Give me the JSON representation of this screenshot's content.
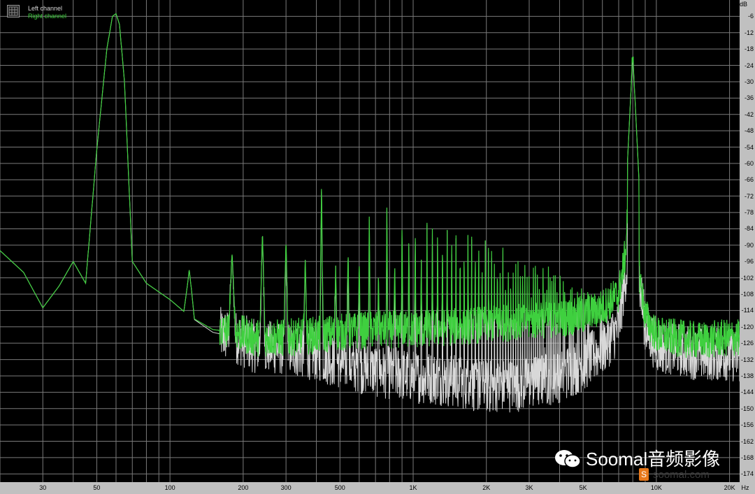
{
  "legend": {
    "left": "Left channel",
    "right": "Right channel",
    "left_color": "#d8d8d8",
    "right_color": "#3fd03f"
  },
  "watermark": {
    "icon": "wechat-icon",
    "text": "Soomal音频影像",
    "badge": "S",
    "site": "soomal.com"
  },
  "chart_data": {
    "type": "line",
    "title": "",
    "xlabel": "Hz",
    "ylabel": "dB",
    "x_scale": "log",
    "xlim": [
      20,
      22000
    ],
    "ylim": [
      -177,
      0
    ],
    "grid": true,
    "background": "#000000",
    "y_ticks": [
      -6,
      -12,
      -18,
      -24,
      -30,
      -36,
      -42,
      -48,
      -54,
      -60,
      -66,
      -72,
      -78,
      -84,
      -90,
      -96,
      -102,
      -108,
      -114,
      -120,
      -126,
      -132,
      -138,
      -144,
      -150,
      -156,
      -162,
      -168,
      -174
    ],
    "x_ticks": [
      {
        "value": 30,
        "label": "30"
      },
      {
        "value": 50,
        "label": "50"
      },
      {
        "value": 100,
        "label": "100"
      },
      {
        "value": 200,
        "label": "200"
      },
      {
        "value": 300,
        "label": "300"
      },
      {
        "value": 500,
        "label": "500"
      },
      {
        "value": 1000,
        "label": "1K"
      },
      {
        "value": 2000,
        "label": "2K"
      },
      {
        "value": 3000,
        "label": "3K"
      },
      {
        "value": 5000,
        "label": "5K"
      },
      {
        "value": 10000,
        "label": "10K"
      },
      {
        "value": 20000,
        "label": "20K"
      }
    ],
    "series": [
      {
        "name": "Left channel",
        "color": "#d8d8d8",
        "x": [
          20,
          25,
          30,
          35,
          40,
          45,
          50,
          55,
          58,
          60,
          62,
          65,
          70,
          80,
          100,
          120,
          150,
          190,
          220,
          300,
          400,
          500,
          700,
          1000,
          1500,
          2000,
          3000,
          4000,
          5000,
          6000,
          7000,
          7500,
          8000,
          8500,
          9000,
          10000,
          12000,
          15000,
          20000,
          22000
        ],
        "y": [
          -92,
          -100,
          -113,
          -105,
          -96,
          -104,
          -55,
          -18,
          -6,
          -5,
          -9,
          -30,
          -96,
          -104,
          -110,
          -116,
          -122,
          -124,
          -127,
          -128,
          -130,
          -133,
          -136,
          -138,
          -140,
          -142,
          -141,
          -138,
          -134,
          -128,
          -120,
          -100,
          -96,
          -103,
          -120,
          -127,
          -128,
          -130,
          -130,
          -131
        ]
      },
      {
        "name": "Right channel",
        "color": "#3fd03f",
        "x": [
          20,
          25,
          30,
          35,
          40,
          45,
          50,
          55,
          58,
          60,
          62,
          65,
          70,
          80,
          100,
          120,
          150,
          190,
          220,
          300,
          400,
          500,
          700,
          1000,
          1500,
          2000,
          3000,
          4000,
          5000,
          6000,
          7000,
          7500,
          8000,
          8500,
          9000,
          10000,
          12000,
          15000,
          20000,
          22000
        ],
        "y": [
          -92,
          -100,
          -113,
          -105,
          -96,
          -104,
          -55,
          -18,
          -6,
          -5,
          -9,
          -30,
          -96,
          -104,
          -110,
          -116,
          -121,
          -122,
          -124,
          -124,
          -123,
          -122,
          -121,
          -121,
          -120,
          -119,
          -118,
          -117,
          -116,
          -113,
          -108,
          -92,
          -20,
          -100,
          -116,
          -123,
          -124,
          -125,
          -124,
          -124
        ]
      }
    ],
    "harmonics": {
      "fundamental_hz": 60,
      "peak_db": [
        -5,
        -99,
        -93,
        -85,
        -88,
        -95,
        -66,
        -97,
        -92,
        -96,
        -78,
        -100,
        -74,
        -96,
        -79,
        -85,
        -83,
        -95,
        -81,
        -82,
        -83,
        -84,
        -84,
        -85,
        -85,
        -86,
        -86,
        -86,
        -86,
        -87,
        -87,
        -87,
        -88,
        -88,
        -88,
        -88,
        -89,
        -89,
        -90,
        -90,
        -90,
        -91,
        -91,
        -91,
        -92,
        -92,
        -92,
        -93,
        -93,
        -93,
        -94,
        -94,
        -94,
        -95,
        -95,
        -96,
        -96,
        -96,
        -97,
        -97,
        -98,
        -98,
        -98,
        -99,
        -99,
        -99,
        -100,
        -100,
        -100,
        -101,
        -101,
        -101,
        -102,
        -102,
        -102,
        -103,
        -103,
        -103,
        -104,
        -104,
        -104,
        -105,
        -105,
        -105,
        -106,
        -106,
        -106,
        -107,
        -107,
        -107,
        -108,
        -108,
        -108,
        -109,
        -109,
        -109,
        -110,
        -110,
        -110,
        -111
      ]
    },
    "tone": {
      "x": 8000,
      "y": -20
    }
  }
}
